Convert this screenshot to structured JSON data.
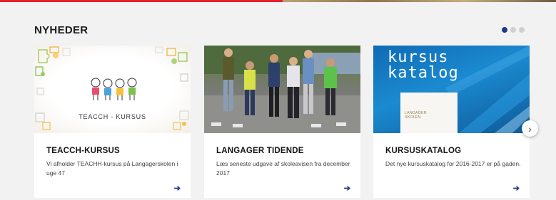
{
  "section": {
    "title": "NYHEDER"
  },
  "carousel": {
    "page_count": 3,
    "active_page": 1,
    "next_icon": "chevron-right-icon"
  },
  "colors": {
    "accent": "#1f3a8a",
    "brand_red": "#e5202c",
    "dot_inactive": "#d0d0d0"
  },
  "cards": [
    {
      "title": "TEACCH-KURSUS",
      "desc": "Vi afholder TEACHH-kursus på Langagerskolen i uge 47",
      "image_label": "TEACCH - KURSUS",
      "arrow_icon": "arrow-right-icon"
    },
    {
      "title": "LANGAGER TIDENDE",
      "desc": "Læs seneste udgave af skoleavisen fra december 2017",
      "arrow_icon": "arrow-right-icon"
    },
    {
      "title": "KURSUSKATALOG",
      "desc": "Det nye kursuskatalog for 2016-2017 er på gaden.",
      "image_text_1": "kursus",
      "image_text_2": "katalog",
      "image_logo_1": "LANGAGER",
      "image_logo_2": "SKOLEN",
      "arrow_icon": "arrow-right-icon"
    }
  ]
}
